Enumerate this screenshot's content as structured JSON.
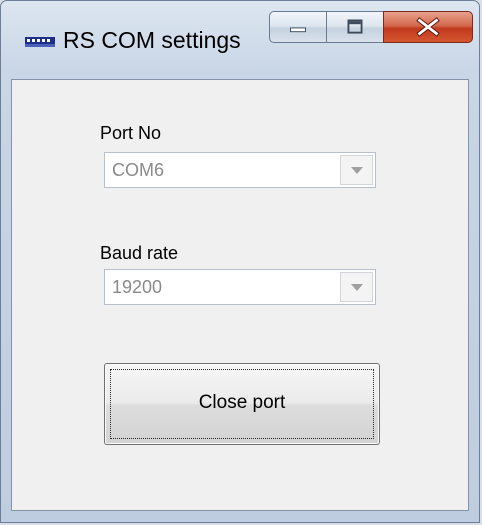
{
  "window": {
    "title": "RS COM settings",
    "icon": "serial-port-icon"
  },
  "caption_buttons": {
    "minimize_icon": "minimize-icon",
    "maximize_icon": "maximize-icon",
    "close_icon": "close-icon"
  },
  "form": {
    "port": {
      "label": "Port No",
      "value": "COM6"
    },
    "baud": {
      "label": "Baud rate",
      "value": "19200"
    },
    "close_button_label": "Close port"
  },
  "colors": {
    "client_background": "#f0f0f0",
    "close_caption_button": "#c23a1e",
    "disabled_text": "#8a8a8a"
  }
}
